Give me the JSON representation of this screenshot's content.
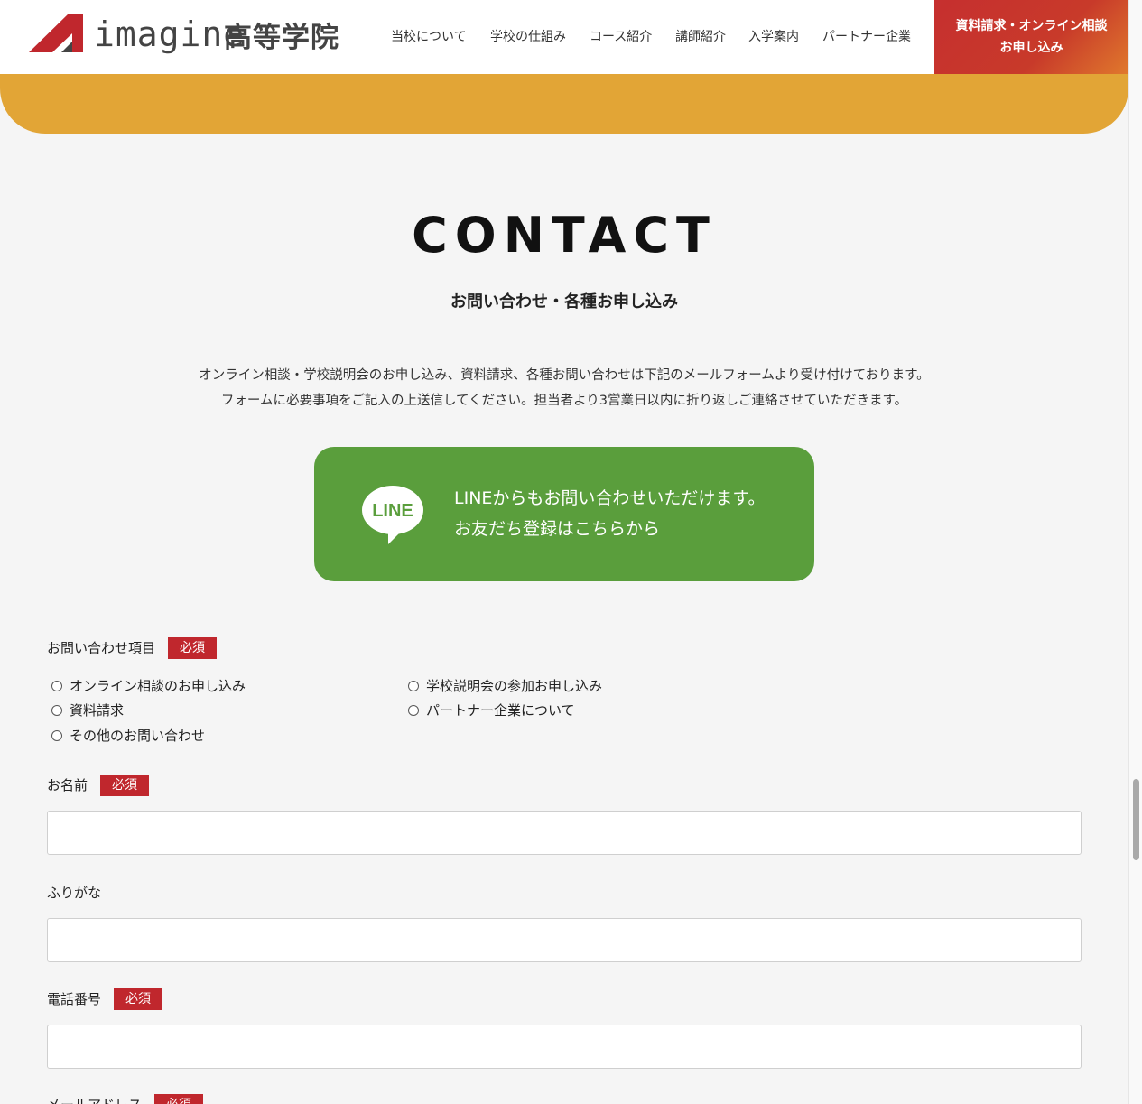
{
  "header": {
    "logo_text": "imagine",
    "logo_jp": "高等学院",
    "nav": [
      "当校について",
      "学校の仕組み",
      "コース紹介",
      "講師紹介",
      "入学案内",
      "パートナー企業"
    ],
    "cta_line1": "資料請求・オンライン相談",
    "cta_line2": "お申し込み"
  },
  "contact": {
    "title": "CONTACT",
    "subtitle": "お問い合わせ・各種お申し込み",
    "intro_line1": "オンライン相談・学校説明会のお申し込み、資料請求、各種お問い合わせは下記のメールフォームより受け付けております。",
    "intro_line2": "フォームに必要事項をご記入の上送信してください。担当者より3営業日以内に折り返しご連絡させていただきます。"
  },
  "line_box": {
    "icon_label": "LINE",
    "line1": "LINEからもお問い合わせいただけます。",
    "line2": "お友だち登録はこちらから"
  },
  "form": {
    "required_label": "必須",
    "inquiry_label": "お問い合わせ項目",
    "options": [
      "オンライン相談のお申し込み",
      "学校説明会の参加お申し込み",
      "資料請求",
      "パートナー企業について",
      "その他のお問い合わせ"
    ],
    "name_label": "お名前",
    "name_value": "",
    "furigana_label": "ふりがな",
    "furigana_value": "",
    "phone_label": "電話番号",
    "phone_value": "",
    "email_label": "メールアドレス"
  },
  "colors": {
    "accent_red": "#c0272d",
    "band_orange": "#e2a536",
    "line_green": "#5a9e3c"
  }
}
